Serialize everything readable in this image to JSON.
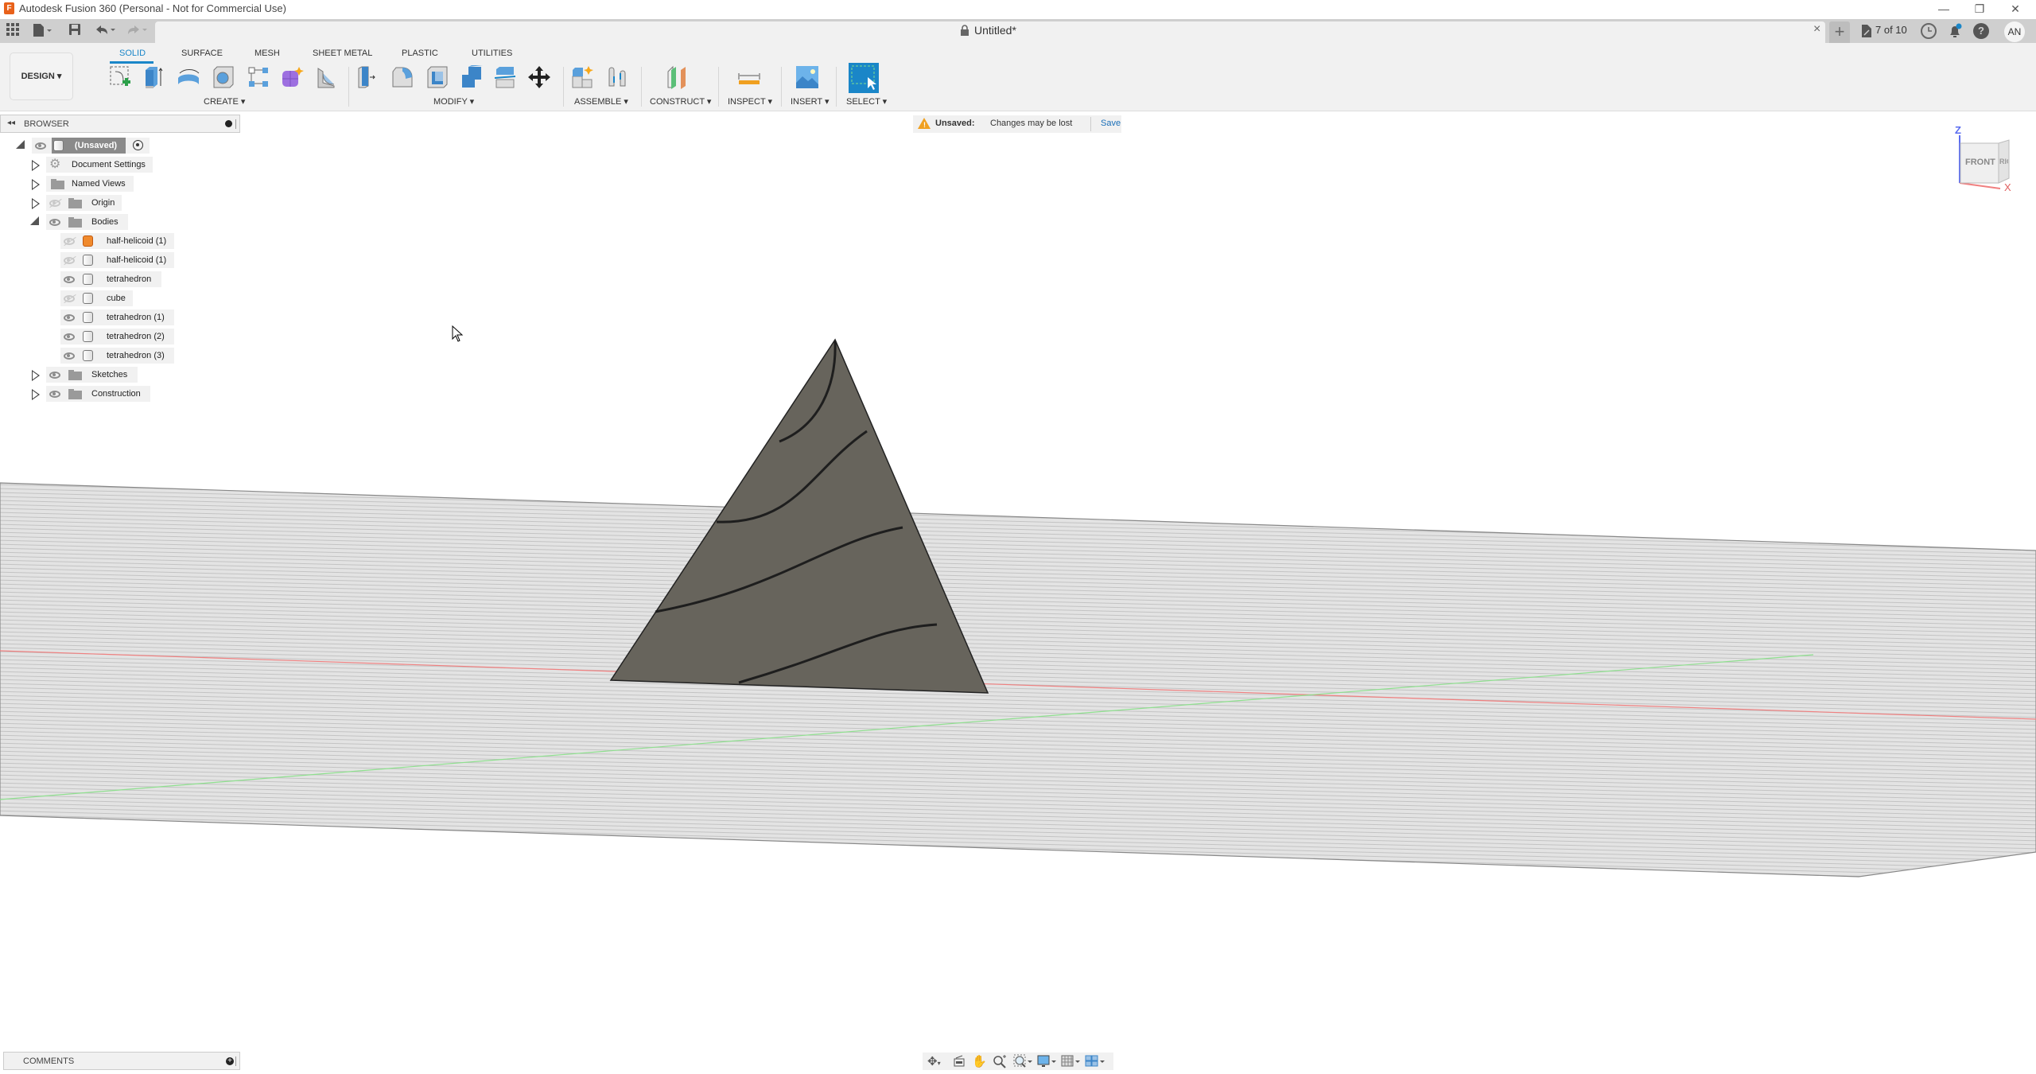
{
  "app": {
    "title": "Autodesk Fusion 360 (Personal - Not for Commercial Use)",
    "logo_letter": "F",
    "window_controls": {
      "minimize": "—",
      "restore": "❐",
      "close": "✕"
    }
  },
  "tabbar": {
    "document_title": "Untitled*",
    "close": "×",
    "new_tab": "+",
    "jobs": "7 of 10",
    "user_initials": "AN",
    "quick_access": {
      "grid": "▦",
      "file": "▾",
      "save": "💾",
      "undo": "↶▾",
      "redo": "↷▾"
    }
  },
  "toolbar": {
    "workspace": "DESIGN ▾",
    "tabs": [
      "SOLID",
      "SURFACE",
      "MESH",
      "SHEET METAL",
      "PLASTIC",
      "UTILITIES"
    ],
    "active_tab": "SOLID",
    "groups": [
      "CREATE ▾",
      "MODIFY ▾",
      "ASSEMBLE ▾",
      "CONSTRUCT ▾",
      "INSPECT ▾",
      "INSERT ▾",
      "SELECT ▾"
    ],
    "tools": {
      "create": [
        "create-sketch",
        "extrude",
        "revolve",
        "hole",
        "pattern",
        "create-form",
        "fillet-shell"
      ],
      "modify": [
        "press-pull",
        "fillet",
        "shell",
        "combine",
        "split-body",
        "move-copy"
      ],
      "assemble": [
        "new-component",
        "joint"
      ],
      "construct": [
        "offset-plane"
      ],
      "inspect": [
        "measure"
      ],
      "insert": [
        "insert-image"
      ],
      "select": [
        "window-select"
      ]
    }
  },
  "browser": {
    "title": "BROWSER",
    "collapse": "◂◂",
    "root": "(Unsaved)",
    "items": [
      {
        "label": "Document Settings",
        "icon": "gear",
        "expand": "closed",
        "eye": null
      },
      {
        "label": "Named Views",
        "icon": "folder",
        "expand": "closed",
        "eye": null
      },
      {
        "label": "Origin",
        "icon": "folder",
        "expand": "closed",
        "eye": "hidden"
      },
      {
        "label": "Bodies",
        "icon": "folder",
        "expand": "open",
        "eye": "visible"
      },
      {
        "label": "Sketches",
        "icon": "folder",
        "expand": "closed",
        "eye": "visible"
      },
      {
        "label": "Construction",
        "icon": "folder",
        "expand": "closed",
        "eye": "visible"
      }
    ],
    "bodies": [
      {
        "label": "half-helicoid (1)",
        "eye": "hidden",
        "selected_icon": true
      },
      {
        "label": "half-helicoid (1)",
        "eye": "hidden",
        "selected_icon": false
      },
      {
        "label": "tetrahedron",
        "eye": "visible",
        "selected_icon": false
      },
      {
        "label": "cube",
        "eye": "hidden",
        "selected_icon": false
      },
      {
        "label": "tetrahedron (1)",
        "eye": "visible",
        "selected_icon": false
      },
      {
        "label": "tetrahedron (2)",
        "eye": "visible",
        "selected_icon": false
      },
      {
        "label": "tetrahedron (3)",
        "eye": "visible",
        "selected_icon": false
      }
    ]
  },
  "banner": {
    "status": "Unsaved:",
    "message": "Changes may be lost",
    "action": "Save"
  },
  "viewcube": {
    "face_front": "FRONT",
    "face_right": "RIGHT",
    "axis_z": "Z",
    "axis_x": "X"
  },
  "comments": {
    "title": "COMMENTS",
    "add": "+"
  },
  "navbar": {
    "items": [
      "orbit",
      "look-at",
      "pan",
      "zoom",
      "fit",
      "display-settings",
      "grid-settings",
      "viewports"
    ]
  },
  "colors": {
    "accent": "#1a86c8",
    "model_face": "#67645c",
    "ground": "#dcdcdc",
    "x_axis": "#f08080",
    "y_axis": "#8fe08f",
    "z_axis": "#5a6cf0",
    "warning": "#f0a020"
  }
}
